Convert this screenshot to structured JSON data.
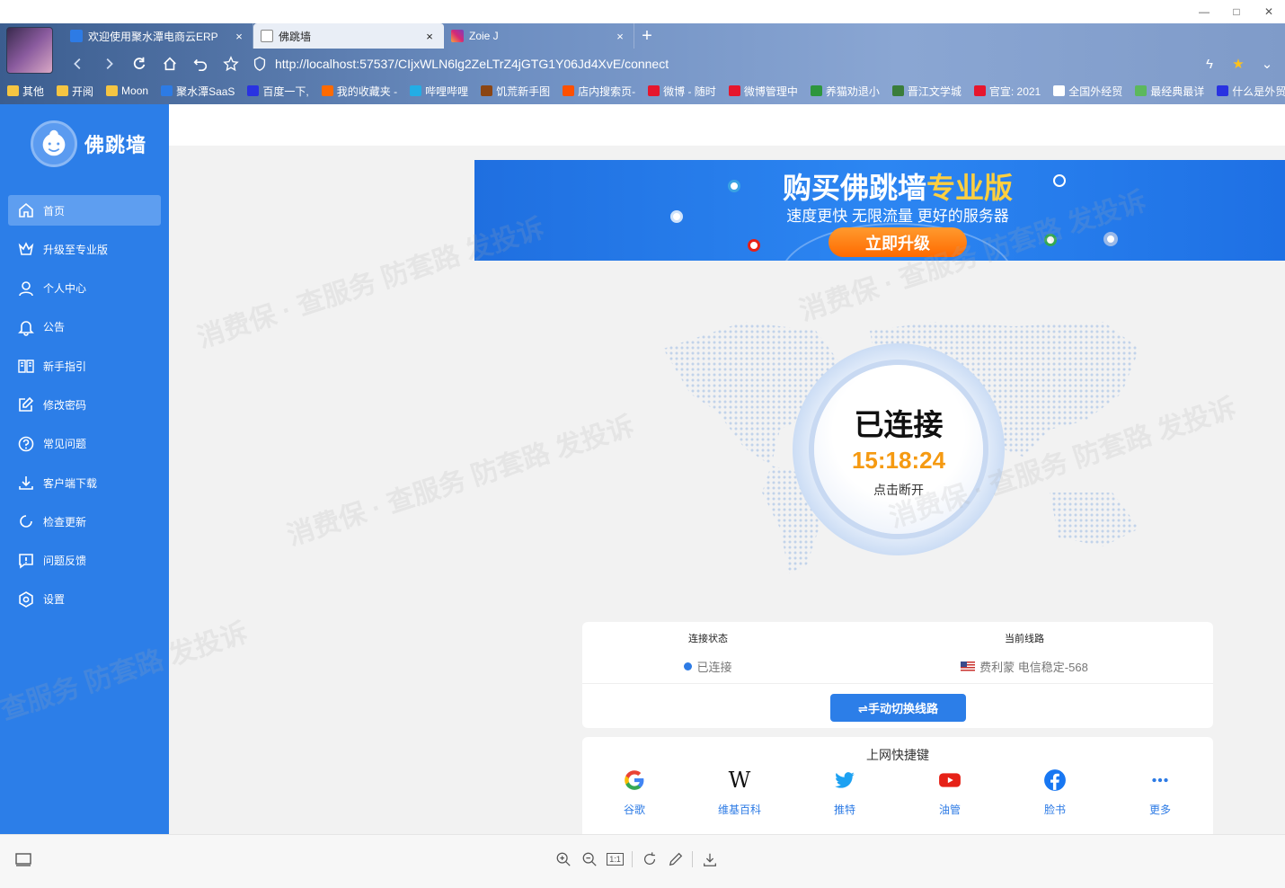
{
  "viewer": {
    "window_controls": [
      "—",
      "□",
      "✕"
    ],
    "tools": [
      "zoom-in",
      "zoom-out",
      "actual-size",
      "rotate",
      "edit",
      "download"
    ],
    "actual_size_label": "1:1"
  },
  "browser": {
    "tabs": [
      {
        "title": "欢迎使用聚水潭电商云ERP",
        "active": false
      },
      {
        "title": "佛跳墙",
        "active": true
      },
      {
        "title": "Zoie J",
        "active": false
      }
    ],
    "new_tab": "+",
    "url": "http://localhost:57537/CIjxWLN6lg2ZeLTrZ4jGTG1Y06Jd4XvE/connect",
    "bookmarks": [
      {
        "label": "其他",
        "color": "#f5c542"
      },
      {
        "label": "开阅",
        "color": "#f5c542"
      },
      {
        "label": "Moon",
        "color": "#f5c542"
      },
      {
        "label": "聚水潭SaaS",
        "color": "#2d7be5"
      },
      {
        "label": "百度一下,",
        "color": "#2932e1"
      },
      {
        "label": "我的收藏夹 -",
        "color": "#ff6a00"
      },
      {
        "label": "哔哩哔哩",
        "color": "#23ade5"
      },
      {
        "label": "饥荒新手图",
        "color": "#8b4513"
      },
      {
        "label": "店内搜索页-",
        "color": "#ff5000"
      },
      {
        "label": "微博 - 随时",
        "color": "#e6162d"
      },
      {
        "label": "微博管理中",
        "color": "#e6162d"
      },
      {
        "label": "养猫劝退小",
        "color": "#2e963d"
      },
      {
        "label": "晋江文学城",
        "color": "#3a7d3a"
      },
      {
        "label": "官宣: 2021",
        "color": "#e6162d"
      },
      {
        "label": "全国外经贸",
        "color": "#ffffff"
      },
      {
        "label": "最经典最详",
        "color": "#5cb85c"
      },
      {
        "label": "什么是外贸",
        "color": "#2932e1"
      }
    ]
  },
  "app": {
    "brand": "佛跳墙",
    "menu": [
      {
        "label": "首页",
        "icon": "home-icon",
        "active": true
      },
      {
        "label": "升级至专业版",
        "icon": "crown-icon",
        "active": false
      },
      {
        "label": "个人中心",
        "icon": "user-icon",
        "active": false
      },
      {
        "label": "公告",
        "icon": "bell-icon",
        "active": false
      },
      {
        "label": "新手指引",
        "icon": "book-icon",
        "active": false
      },
      {
        "label": "修改密码",
        "icon": "edit-icon",
        "active": false
      },
      {
        "label": "常见问题",
        "icon": "question-icon",
        "active": false
      },
      {
        "label": "客户端下载",
        "icon": "download-icon",
        "active": false
      },
      {
        "label": "检查更新",
        "icon": "refresh-icon",
        "active": false
      },
      {
        "label": "问题反馈",
        "icon": "feedback-icon",
        "active": false
      },
      {
        "label": "设置",
        "icon": "settings-icon",
        "active": false
      }
    ],
    "banner": {
      "title_plain": "购买佛跳墙",
      "title_highlight": "专业版",
      "subtitle": "速度更快 无限流量 更好的服务器",
      "button": "立即升级",
      "highlight_color": "#ffcf3f"
    },
    "connection": {
      "status": "已连接",
      "timer": "15:18:24",
      "hint": "点击断开",
      "timer_color": "#f59a12"
    },
    "status_card": {
      "state_label": "连接状态",
      "state_value": "已连接",
      "route_label": "当前线路",
      "route_value": "费利蒙 电信稳定-568",
      "switch_button": "⇌手动切换线路"
    },
    "shortcuts": {
      "title": "上网快捷键",
      "items": [
        {
          "label": "谷歌",
          "icon": "google-icon"
        },
        {
          "label": "维基百科",
          "icon": "wikipedia-icon"
        },
        {
          "label": "推特",
          "icon": "twitter-icon"
        },
        {
          "label": "油管",
          "icon": "youtube-icon"
        },
        {
          "label": "脸书",
          "icon": "facebook-icon"
        },
        {
          "label": "更多",
          "icon": "more-icon"
        }
      ]
    },
    "accent_color": "#2c7ee8"
  },
  "watermark": "消费保 · 查服务 防套路 发投诉"
}
